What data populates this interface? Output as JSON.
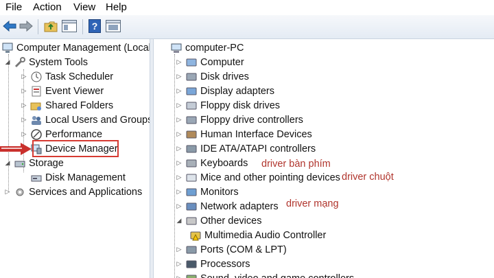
{
  "menu": [
    "File",
    "Action",
    "View",
    "Help"
  ],
  "toolbar_icons": [
    "back-icon",
    "forward-icon",
    "up-folder-icon",
    "show-hide-tree-icon",
    "help-icon",
    "properties-icon"
  ],
  "left_tree": {
    "root": "Computer Management (Local",
    "system_tools": "System Tools",
    "task_scheduler": "Task Scheduler",
    "event_viewer": "Event Viewer",
    "shared_folders": "Shared Folders",
    "local_users": "Local Users and Groups",
    "performance": "Performance",
    "device_manager": "Device Manager",
    "storage": "Storage",
    "disk_management": "Disk Management",
    "services": "Services and Applications"
  },
  "devices": {
    "root": "computer-PC",
    "items": [
      "Computer",
      "Disk drives",
      "Display adapters",
      "Floppy disk drives",
      "Floppy drive controllers",
      "Human Interface Devices",
      "IDE ATA/ATAPI controllers",
      "Keyboards",
      "Mice and other pointing devices",
      "Monitors",
      "Network adapters",
      "Other devices",
      "Multimedia Audio Controller",
      "Ports (COM & LPT)",
      "Processors",
      "Sound, video and game controllers"
    ]
  },
  "annotations": {
    "keyboard": "driver bàn phím",
    "mouse": "driver chuột",
    "network": "driver mạng"
  },
  "colors": {
    "highlight": "#d63b32",
    "annotation": "#b0342c"
  }
}
